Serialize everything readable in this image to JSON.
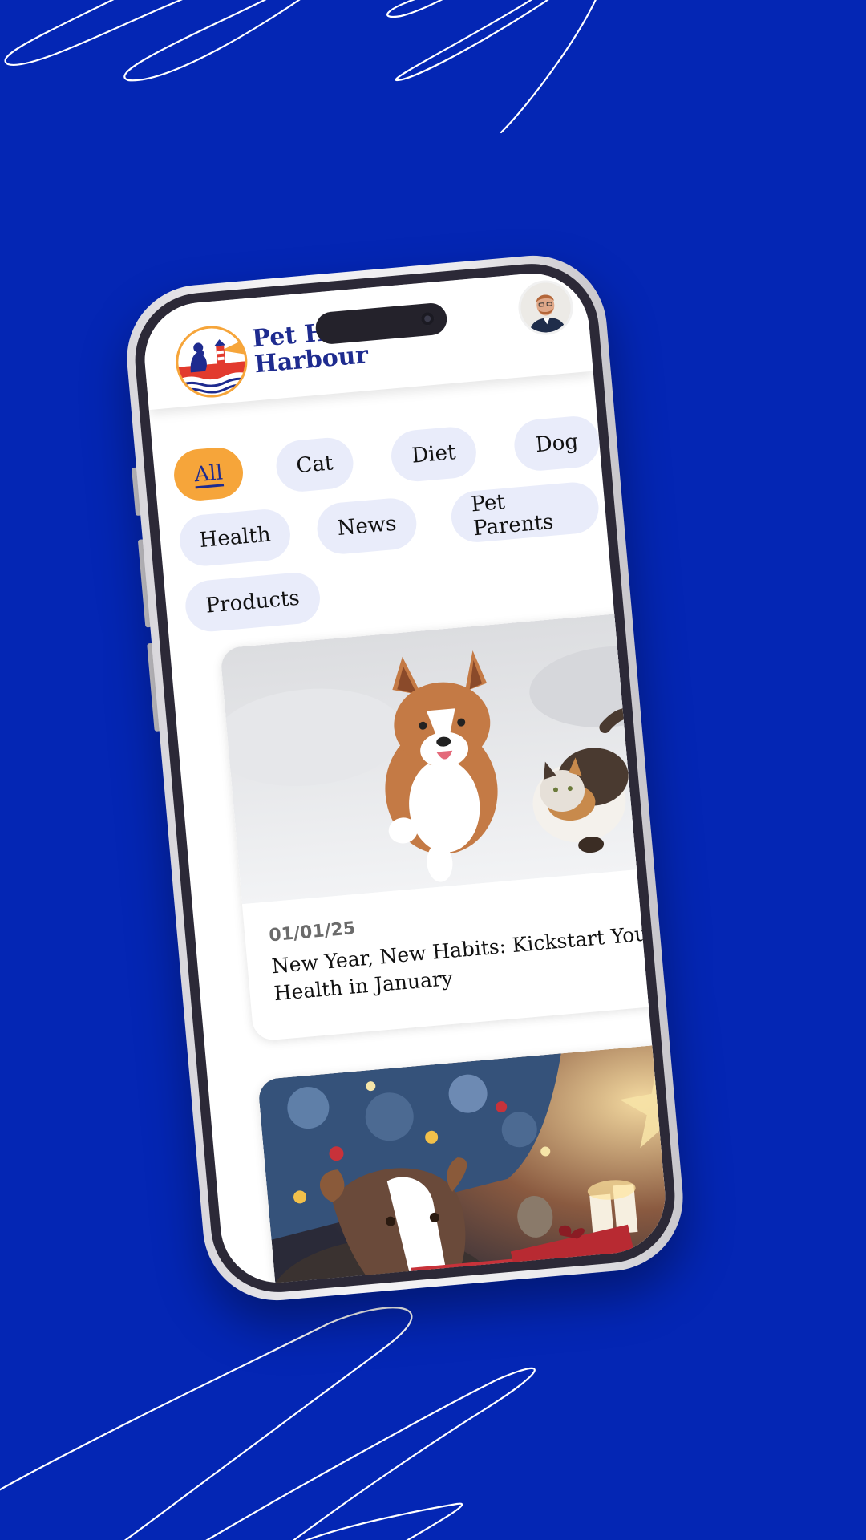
{
  "app": {
    "brand_line1": "Pet Health",
    "brand_line2": "Harbour"
  },
  "filters": {
    "chips": [
      "All",
      "Cat",
      "Diet",
      "Dog",
      "Health",
      "News",
      "Pet Parents",
      "Products"
    ],
    "selected": "All"
  },
  "articles": [
    {
      "date": "01/01/25",
      "title_line1": "New Year, New Habits: Kickstart Your Pet's",
      "title_line2": "Health in January",
      "image": "corgi-and-cat-running-in-snow"
    },
    {
      "date": "",
      "title_line1": "",
      "title_line2": "",
      "image": "dog-by-christmas-tree-with-gifts"
    }
  ],
  "colors": {
    "background": "#0426b4",
    "brand_blue": "#1e2b8f",
    "chip_active": "#f6a53a",
    "chip_inactive": "#e9ecfa"
  }
}
